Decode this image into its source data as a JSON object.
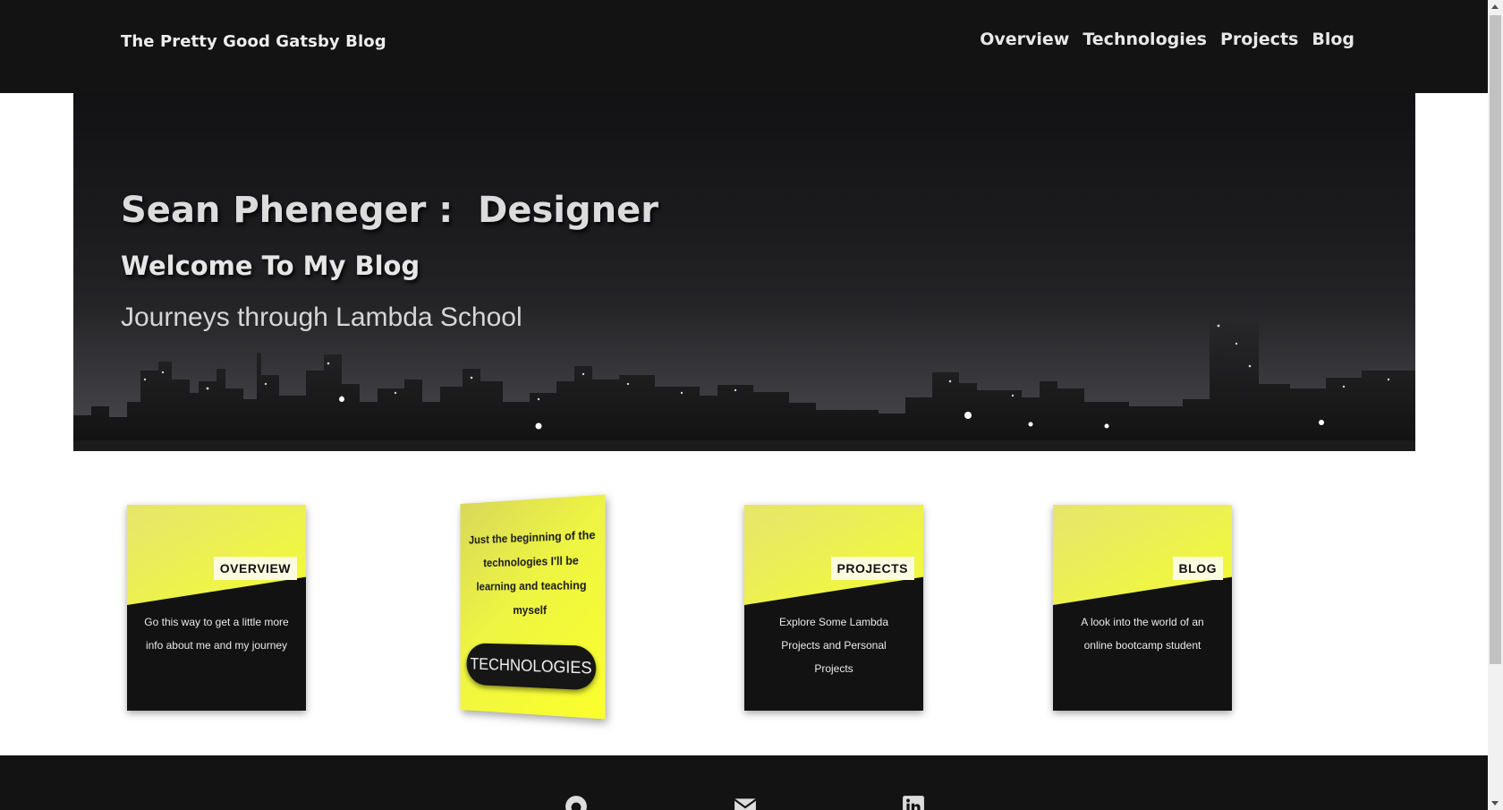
{
  "header": {
    "brand": "The Pretty Good Gatsby Blog",
    "nav": [
      {
        "label": "Overview"
      },
      {
        "label": "Technologies"
      },
      {
        "label": "Projects"
      },
      {
        "label": "Blog"
      }
    ]
  },
  "hero": {
    "title": "Sean Pheneger :  Designer",
    "subtitle": "Welcome To My Blog",
    "tagline": "Journeys through Lambda School"
  },
  "cards": {
    "overview": {
      "label": "OVERVIEW",
      "text": "Go this way to get a little more info about me and my journey"
    },
    "technologies": {
      "text": "Just the beginning of the technologies I'll be learning and teaching myself",
      "button": "TECHNOLOGIES"
    },
    "projects": {
      "label": "PROJECTS",
      "text": "Explore Some Lambda Projects and Personal Projects"
    },
    "blog": {
      "label": "BLOG",
      "text": "A look into the world of an online bootcamp student"
    }
  },
  "footer": {
    "icons": [
      "github-icon",
      "email-icon",
      "linkedin-icon"
    ]
  },
  "colors": {
    "dark": "#131314",
    "accent_yellow": "#f3fb33",
    "white": "#ffffff"
  }
}
